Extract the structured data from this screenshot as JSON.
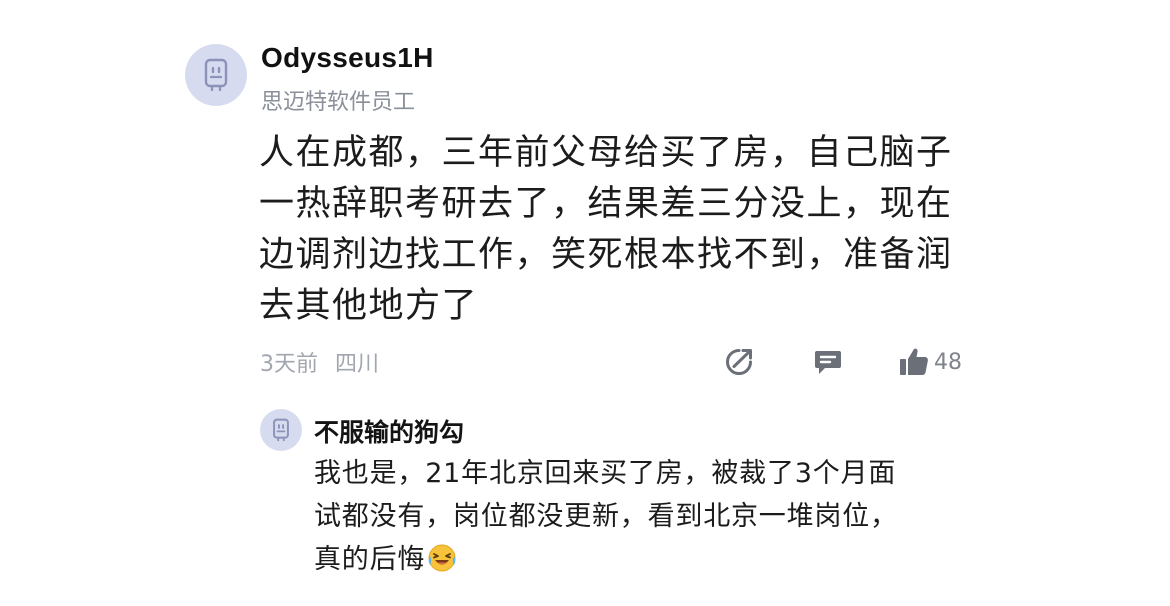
{
  "comment": {
    "username": "Odysseus1H",
    "user_tag": "思迈特软件员工",
    "avatar_icon": "robot-icon",
    "content_lines": [
      "人在成都，三年前父母给买了房，自己脑子",
      "一热辞职考研去了，结果差三分没上，现在",
      "边调剂边找工作，笑死根本找不到，准备润",
      "去其他地方了"
    ],
    "time": "3天前",
    "location": "四川",
    "actions": {
      "share_icon": "share-icon",
      "reply_icon": "comment-icon",
      "like_icon": "thumbs-up-icon",
      "like_count": "48"
    }
  },
  "reply": {
    "username": "不服输的狗勾",
    "avatar_icon": "robot-icon",
    "content_lines": [
      "我也是，21年北京回来买了房，被裁了3个月面",
      "试都没有，岗位都没更新，看到北京一堆岗位，",
      "真的后悔"
    ],
    "trailing_emoji": "laughing-crying-emoji"
  },
  "colors": {
    "avatar_bg": "#d6dbef",
    "avatar_fg": "#8c92b8",
    "meta_text": "#a2a6ae",
    "icon_gray": "#6b6f77"
  }
}
